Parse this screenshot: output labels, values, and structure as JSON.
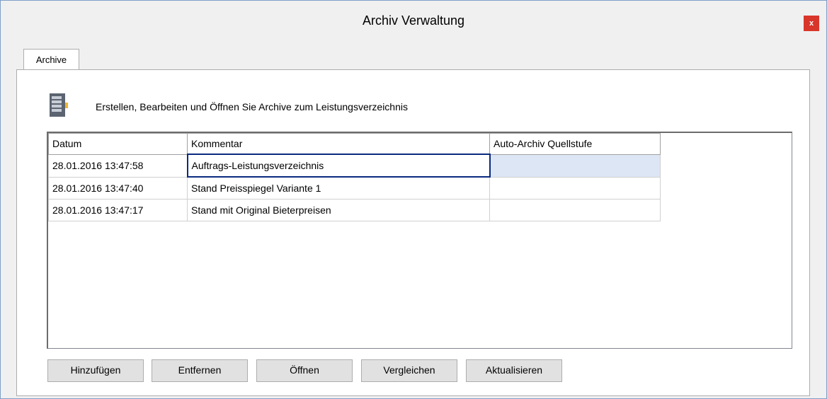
{
  "window": {
    "title": "Archiv Verwaltung",
    "close_label": "x"
  },
  "tabs": [
    {
      "label": "Archive"
    }
  ],
  "description": "Erstellen, Bearbeiten und Öffnen Sie Archive zum Leistungsverzeichnis",
  "table": {
    "columns": [
      "Datum",
      "Kommentar",
      "Auto-Archiv Quellstufe"
    ],
    "rows": [
      {
        "datum": "28.01.2016 13:47:58",
        "kommentar": "Auftrags-Leistungsverzeichnis",
        "quelle": ""
      },
      {
        "datum": "28.01.2016 13:47:40",
        "kommentar": "Stand Preisspiegel Variante 1",
        "quelle": ""
      },
      {
        "datum": "28.01.2016 13:47:17",
        "kommentar": "Stand mit Original Bieterpreisen",
        "quelle": ""
      }
    ]
  },
  "buttons": {
    "add": "Hinzufügen",
    "remove": "Entfernen",
    "open": "Öffnen",
    "compare": "Vergleichen",
    "refresh": "Aktualisieren"
  },
  "colors": {
    "close": "#d9362b",
    "selection": "#dce6f4",
    "edit_border": "#0a2a80"
  }
}
